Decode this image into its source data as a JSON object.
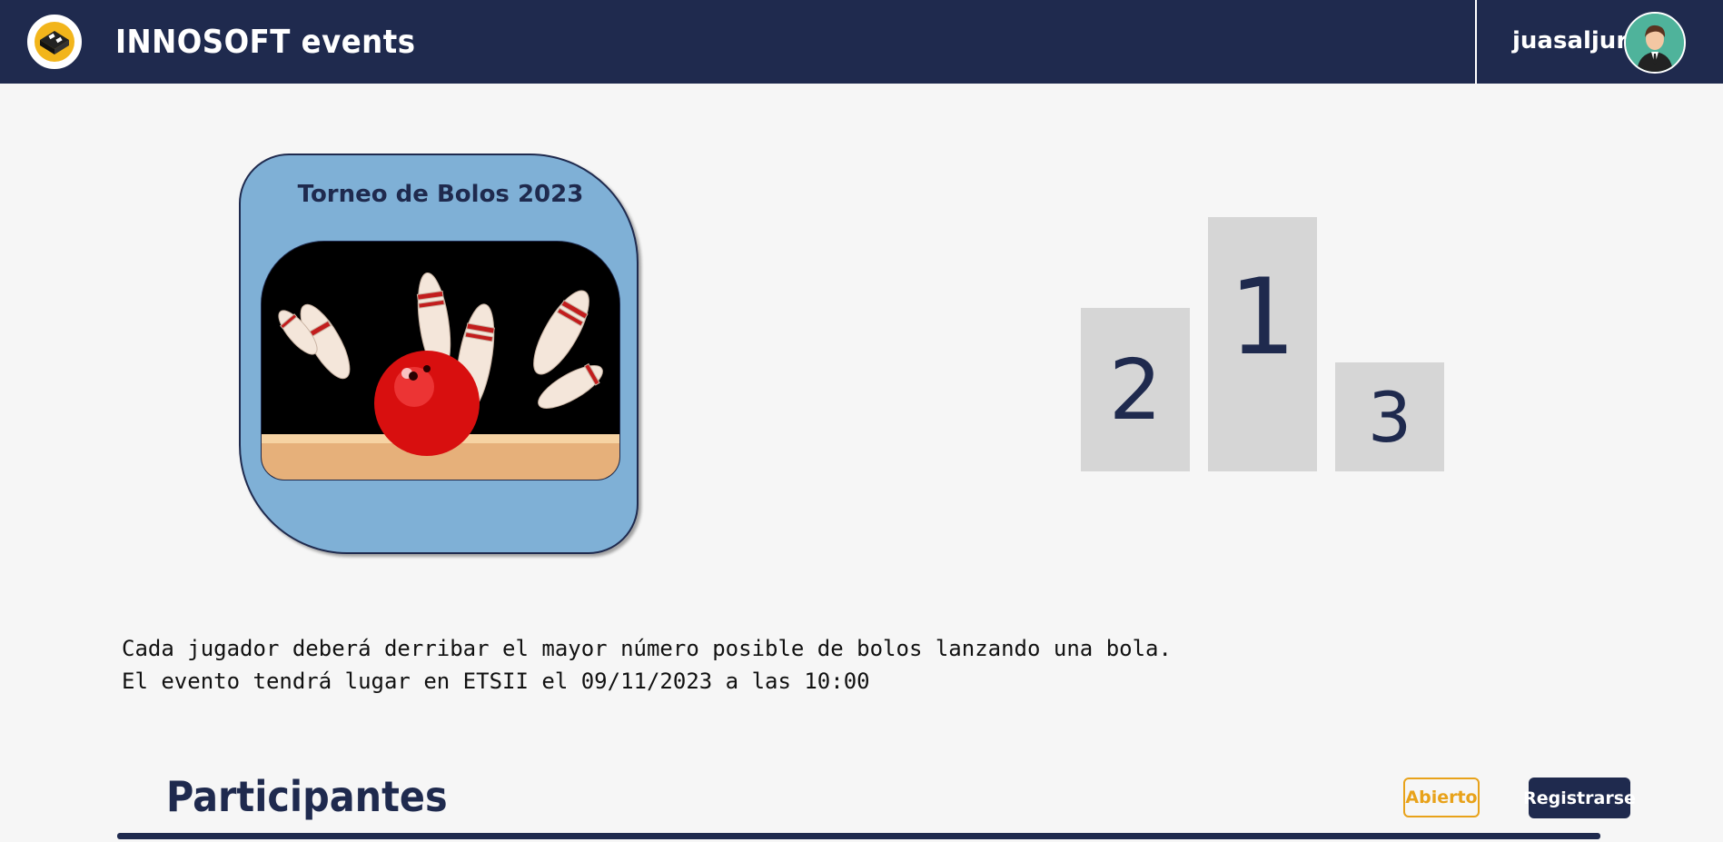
{
  "header": {
    "brand": "INNOSOFT events",
    "username": "juasaljur",
    "logo_icon": "keyboard-logo-icon",
    "avatar_icon": "user-avatar-icon"
  },
  "event": {
    "title": "Torneo de Bolos 2023",
    "image_icon": "bowling-image",
    "description_line1": "Cada jugador deberá derribar el mayor número posible de bolos lanzando una bola.",
    "description_line2": "El evento tendrá lugar en ETSII el 09/11/2023 a las 10:00"
  },
  "podium": {
    "first": "1",
    "second": "2",
    "third": "3"
  },
  "participants": {
    "heading": "Participantes",
    "status": "Abierto",
    "register_label": "Registrarse"
  },
  "colors": {
    "navy": "#1f2a4e",
    "card": "#7fb0d6",
    "status": "#e8a21a",
    "podium": "#d6d6d6"
  }
}
